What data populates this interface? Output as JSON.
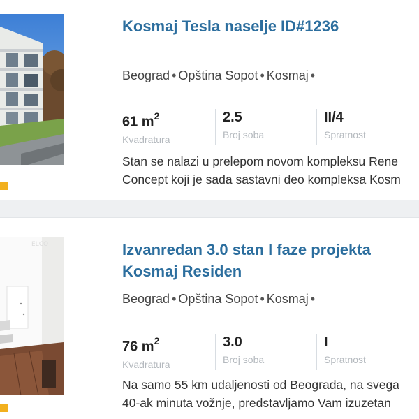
{
  "listings": [
    {
      "title_lines": [
        "Kosmaj Tesla naselje ID#1236"
      ],
      "location": [
        "Beograd",
        "Opština Sopot",
        "Kosmaj"
      ],
      "area": "61 m",
      "area_sup": "2",
      "area_label": "Kvadratura",
      "rooms": "2.5",
      "rooms_label": "Broj soba",
      "floor": "II/4",
      "floor_label": "Spratnost",
      "description_lines": [
        "Stan se nalazi u prelepom novom kompleksu Rene",
        "Concept koji je sada sastavni deo kompleksa Kosm"
      ]
    },
    {
      "title_lines": [
        "Izvanredan 3.0 stan I faze projekta",
        "Kosmaj Residen"
      ],
      "location": [
        "Beograd",
        "Opština Sopot",
        "Kosmaj"
      ],
      "area": "76 m",
      "area_sup": "2",
      "area_label": "Kvadratura",
      "rooms": "3.0",
      "rooms_label": "Broj soba",
      "floor": "I",
      "floor_label": "Spratnost",
      "description_lines": [
        "Na samo 55 km udaljenosti od Beograda, na svega",
        "40-ak minuta vožnje, predstavljamo Vam izuzetan"
      ]
    }
  ],
  "colors": {
    "title": "#2c6e9e",
    "badge": "#f2b01e",
    "label": "#b4b9be"
  }
}
